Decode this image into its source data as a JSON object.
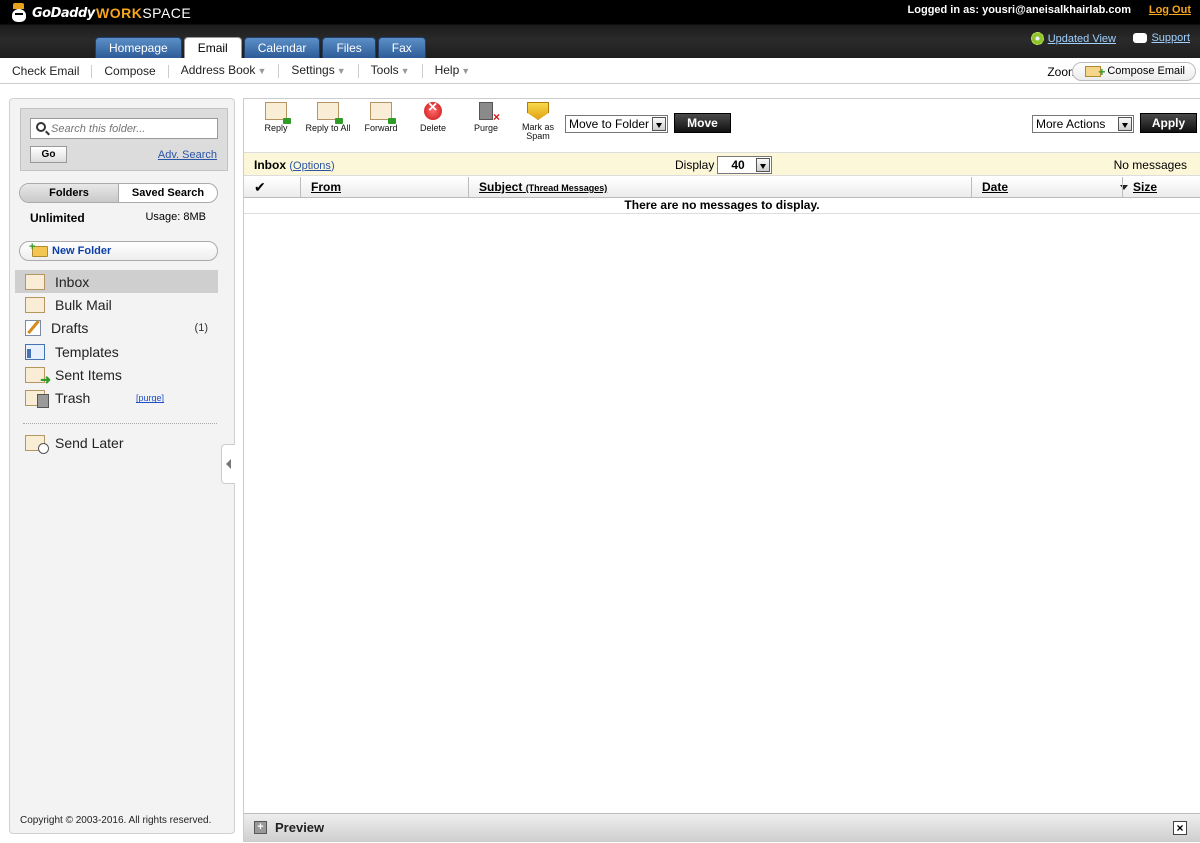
{
  "header": {
    "logo_text": "GoDaddy",
    "workspace_1": "WORK",
    "workspace_2": "SPACE",
    "login_text": "Logged in as: yousri@aneisalkhairlab.com",
    "logout_label": "Log Out",
    "updated_view_label": "Updated View",
    "support_label": "Support",
    "tabs": [
      {
        "label": "Homepage",
        "active": false
      },
      {
        "label": "Email",
        "active": true
      },
      {
        "label": "Calendar",
        "active": false
      },
      {
        "label": "Files",
        "active": false
      },
      {
        "label": "Fax",
        "active": false
      }
    ]
  },
  "menu": {
    "items": [
      "Check Email",
      "Compose",
      "Address Book",
      "Settings",
      "Tools",
      "Help"
    ],
    "zoom_label": "Zoom",
    "compose_email_label": "Compose Email"
  },
  "sidebar": {
    "search_placeholder": "Search this folder...",
    "go_label": "Go",
    "adv_search_label": "Adv. Search",
    "tab_folders": "Folders",
    "tab_saved_search": "Saved Search",
    "quota_label": "Unlimited",
    "usage_label": "Usage: 8MB",
    "new_folder_label": "New Folder",
    "folders": [
      {
        "name": "Inbox",
        "count": "",
        "icon": "envelope-icon"
      },
      {
        "name": "Bulk Mail",
        "count": "",
        "icon": "envelope-icon"
      },
      {
        "name": "Drafts",
        "count": "(1)",
        "icon": "pencil-icon"
      },
      {
        "name": "Templates",
        "count": "",
        "icon": "template-icon"
      },
      {
        "name": "Sent Items",
        "count": "",
        "icon": "sent-icon"
      },
      {
        "name": "Trash",
        "count": "",
        "icon": "trash-icon"
      }
    ],
    "trash_purge_label": "[purge]",
    "send_later_label": "Send Later",
    "copyright": "Copyright © 2003-2016. All rights reserved."
  },
  "toolbar": {
    "reply": "Reply",
    "reply_all": "Reply to All",
    "forward": "Forward",
    "delete": "Delete",
    "purge": "Purge",
    "mark_spam_1": "Mark as",
    "mark_spam_2": "Spam",
    "move_to_folder": "Move to Folder",
    "move_label": "Move",
    "more_actions": "More Actions",
    "apply_label": "Apply"
  },
  "inbox_bar": {
    "title": "Inbox",
    "options_open": "(",
    "options_label": "Options",
    "options_close": ")",
    "display_label": "Display",
    "display_value": "40",
    "status": "No messages"
  },
  "columns": {
    "from": "From",
    "subject": "Subject",
    "thread_messages": "(Thread Messages)",
    "date": "Date",
    "size": "Size"
  },
  "empty_message": "There are no messages to display.",
  "preview": {
    "label": "Preview"
  }
}
